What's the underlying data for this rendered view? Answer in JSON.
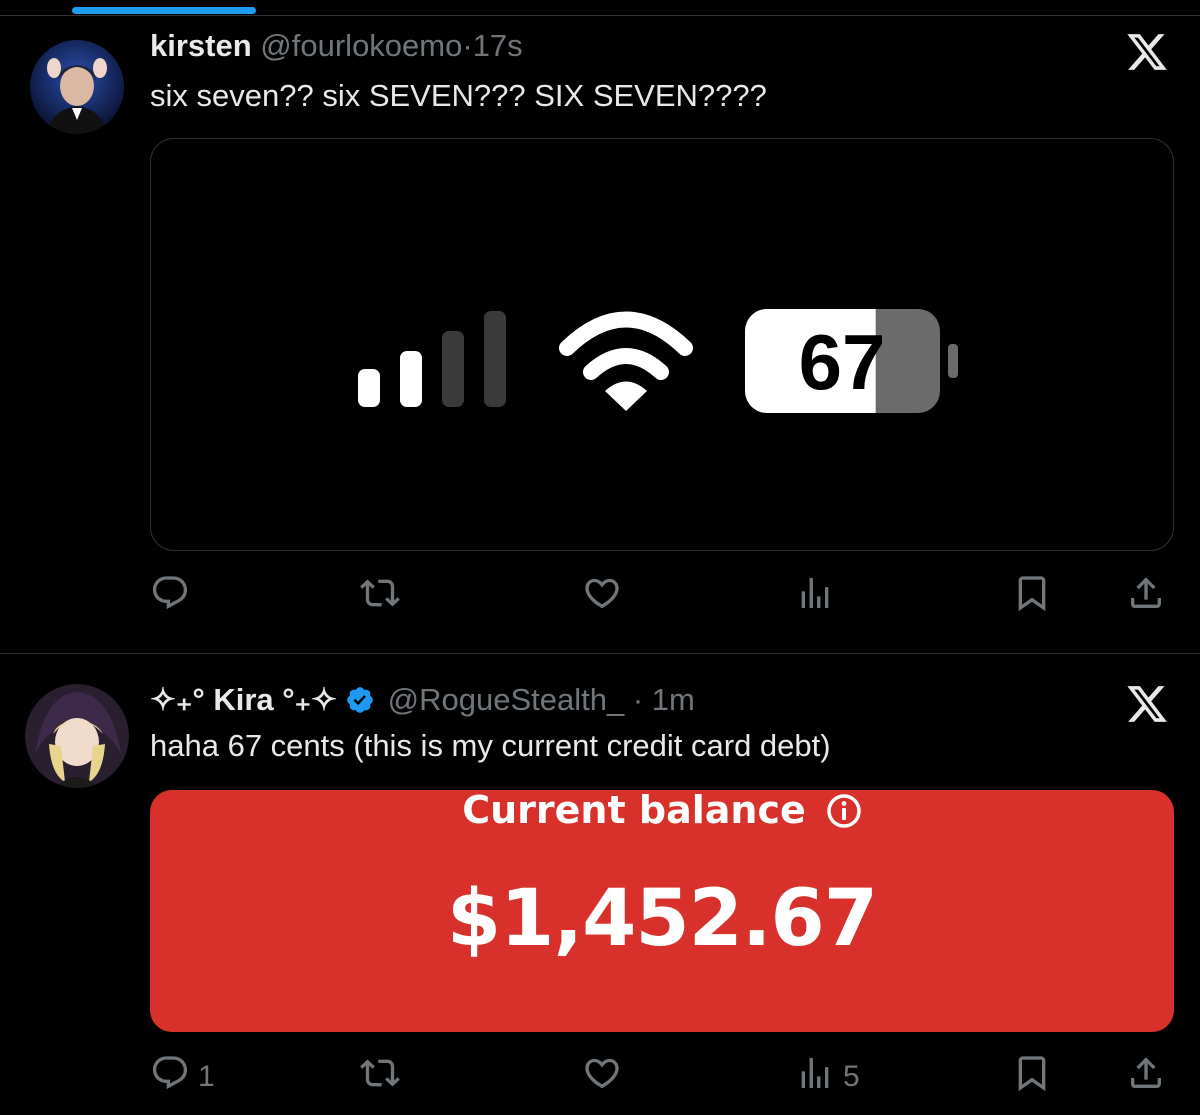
{
  "tweets": [
    {
      "name": "kirsten",
      "handle": "@fourlokoemo",
      "separator": "·",
      "time": "17s",
      "text": "six seven?? six SEVEN??? SIX SEVEN????",
      "media": {
        "battery_text": "67",
        "battery_level": 0.67,
        "signal_bars_filled": 2,
        "signal_bars_total": 4
      },
      "actions": {
        "replies": "",
        "views": ""
      }
    },
    {
      "name": "✧₊° Kira °₊✧",
      "handle": "@RogueStealth_",
      "separator": "·",
      "time": "1m",
      "verified": true,
      "text": "haha 67 cents (this is my current credit card debt)",
      "media": {
        "label": "Current balance",
        "amount": "$1,452.67",
        "background": "#d8302a"
      },
      "actions": {
        "replies": "1",
        "views": "5"
      }
    }
  ],
  "colors": {
    "accent": "#1d9bf0",
    "muted": "#71767b",
    "text": "#e7e9ea",
    "divider": "#2f3336"
  },
  "icons": [
    "reply-icon",
    "retweet-icon",
    "like-icon",
    "views-icon",
    "bookmark-icon",
    "share-icon",
    "x-logo-icon",
    "verified-badge-icon",
    "info-icon"
  ]
}
